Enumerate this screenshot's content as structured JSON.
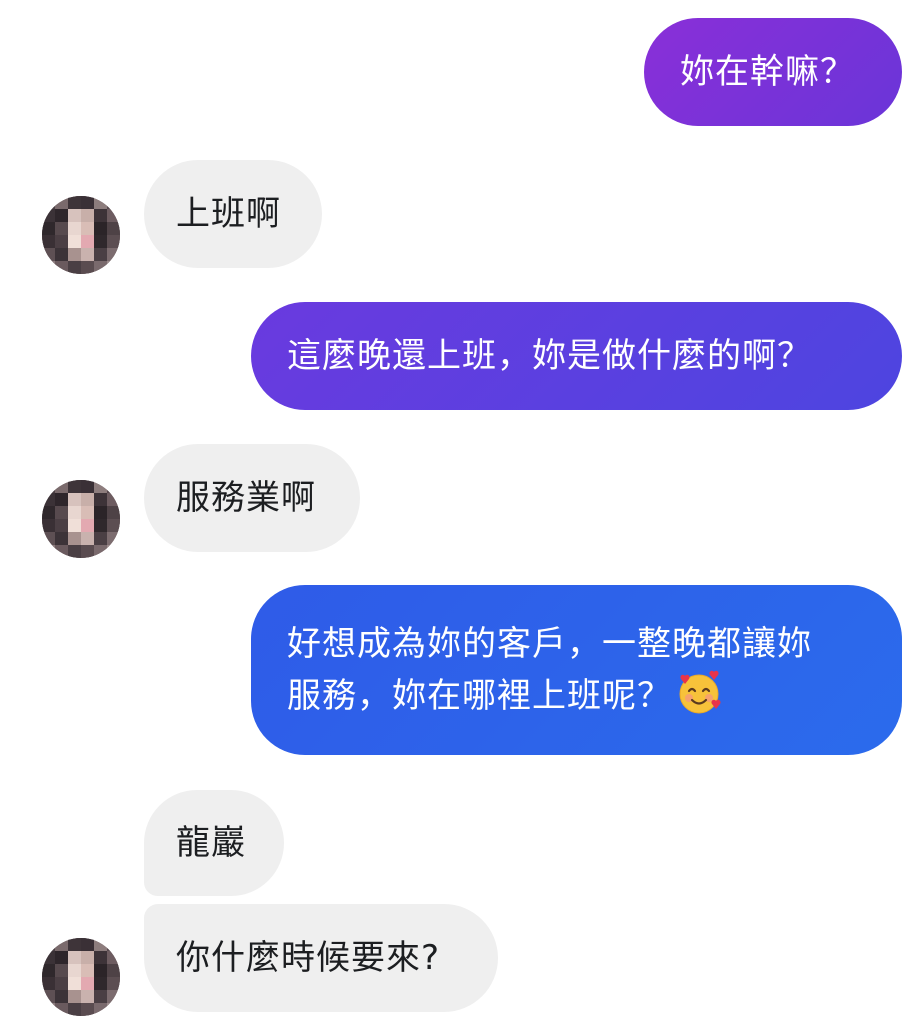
{
  "conversation": {
    "messages": [
      {
        "from": "me",
        "text": "妳在幹嘛？"
      },
      {
        "from": "them",
        "text": "上班啊"
      },
      {
        "from": "me",
        "text": "這麼晚還上班，妳是做什麼的啊？"
      },
      {
        "from": "them",
        "text": "服務業啊"
      },
      {
        "from": "me",
        "line1": "好想成為妳的客戶，一整晚都讓妳",
        "line2": "服務，妳在哪裡上班呢？",
        "emoji": "smiling-face-with-hearts"
      },
      {
        "from": "them",
        "text": "龍巖"
      },
      {
        "from": "them",
        "text": "你什麼時候要來?"
      }
    ]
  },
  "colors": {
    "sent_purple": "#7a32d6",
    "sent_indigo": "#5b3fe0",
    "sent_blue": "#2f62ea",
    "received_bg": "#efefef",
    "received_text": "#1c1e21"
  }
}
